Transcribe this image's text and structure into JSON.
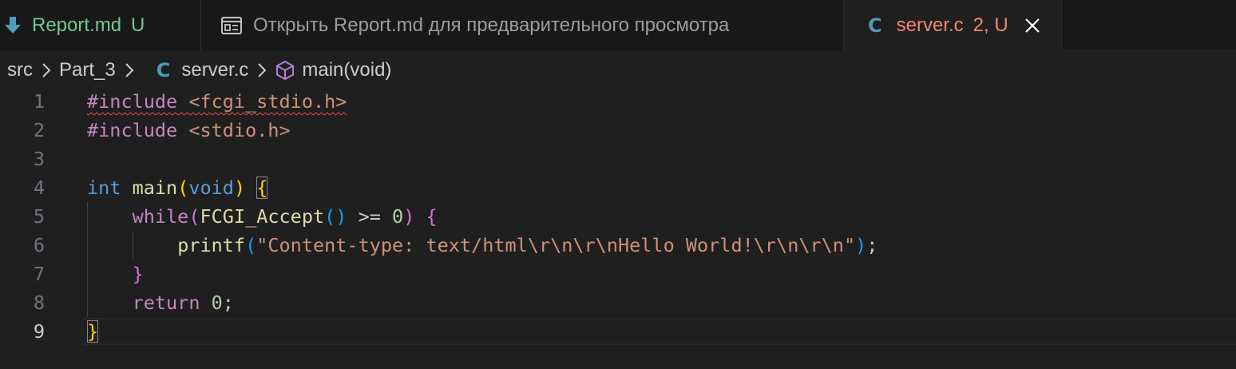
{
  "tabs": [
    {
      "name": "Report.md",
      "status": "U",
      "colors": {
        "name": "#73c991",
        "status": "#73c991",
        "icon": "#519aba"
      },
      "icon": "markdown-download-icon"
    },
    {
      "name": "Открыть Report.md для предварительного просмотра",
      "colors": {
        "name": "#9d9d9d"
      },
      "icon": "preview-icon"
    },
    {
      "name": "server.c",
      "status": "2, U",
      "active": true,
      "colors": {
        "name": "#f48771",
        "status": "#f48771"
      },
      "icon": "c-language-icon",
      "icon_text": "C"
    }
  ],
  "breadcrumb": {
    "items": [
      "src",
      "Part_3",
      "server.c",
      "main(void)"
    ],
    "file_icon_text": "C",
    "symbol_icon": "cube-method-icon"
  },
  "editor": {
    "current_line": 9,
    "lines": [
      {
        "n": "1",
        "tokens": [
          {
            "t": "#include",
            "c": "t-kw",
            "sq": true
          },
          {
            "t": " ",
            "c": "t-plain",
            "sq": true
          },
          {
            "t": "<fcgi_stdio.h>",
            "c": "t-str",
            "sq": true
          }
        ]
      },
      {
        "n": "2",
        "tokens": [
          {
            "t": "#include",
            "c": "t-kw"
          },
          {
            "t": " ",
            "c": "t-plain"
          },
          {
            "t": "<stdio.h>",
            "c": "t-str"
          }
        ]
      },
      {
        "n": "3",
        "tokens": []
      },
      {
        "n": "4",
        "tokens": [
          {
            "t": "int",
            "c": "t-type"
          },
          {
            "t": " ",
            "c": "t-plain"
          },
          {
            "t": "main",
            "c": "t-fn"
          },
          {
            "t": "(",
            "c": "t-br1"
          },
          {
            "t": "void",
            "c": "t-type"
          },
          {
            "t": ")",
            "c": "t-br1"
          },
          {
            "t": " ",
            "c": "t-plain"
          },
          {
            "t": "{",
            "c": "t-br1",
            "match": true
          }
        ]
      },
      {
        "n": "5",
        "tokens": [
          {
            "t": "    ",
            "c": "t-plain"
          },
          {
            "t": "while",
            "c": "t-kw"
          },
          {
            "t": "(",
            "c": "t-br2"
          },
          {
            "t": "FCGI_Accept",
            "c": "t-fn"
          },
          {
            "t": "()",
            "c": "t-br3"
          },
          {
            "t": " >= ",
            "c": "t-plain"
          },
          {
            "t": "0",
            "c": "t-num"
          },
          {
            "t": ")",
            "c": "t-br2"
          },
          {
            "t": " ",
            "c": "t-plain"
          },
          {
            "t": "{",
            "c": "t-br2"
          }
        ]
      },
      {
        "n": "6",
        "tokens": [
          {
            "t": "        ",
            "c": "t-plain"
          },
          {
            "t": "printf",
            "c": "t-fn"
          },
          {
            "t": "(",
            "c": "t-br3"
          },
          {
            "t": "\"Content-type: text/html\\r\\n\\r\\nHello World!\\r\\n\\r\\n\"",
            "c": "t-str"
          },
          {
            "t": ")",
            "c": "t-br3"
          },
          {
            "t": ";",
            "c": "t-plain"
          }
        ]
      },
      {
        "n": "7",
        "tokens": [
          {
            "t": "    ",
            "c": "t-plain"
          },
          {
            "t": "}",
            "c": "t-br2"
          }
        ]
      },
      {
        "n": "8",
        "tokens": [
          {
            "t": "    ",
            "c": "t-plain"
          },
          {
            "t": "return",
            "c": "t-kw"
          },
          {
            "t": " ",
            "c": "t-plain"
          },
          {
            "t": "0",
            "c": "t-num"
          },
          {
            "t": ";",
            "c": "t-plain"
          }
        ]
      },
      {
        "n": "9",
        "tokens": [
          {
            "t": "}",
            "c": "t-br1",
            "match": true
          }
        ]
      }
    ]
  }
}
